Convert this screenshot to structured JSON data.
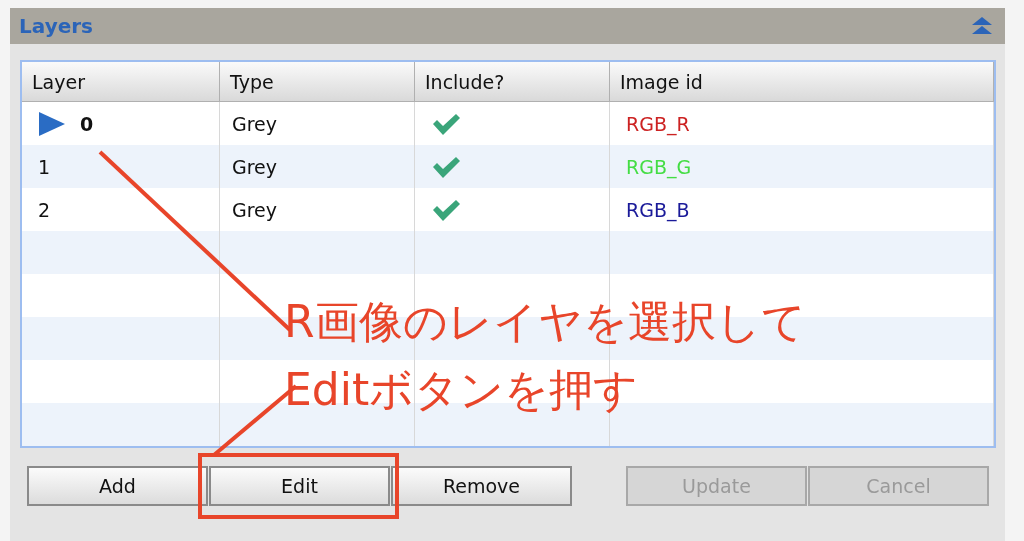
{
  "panel": {
    "title": "Layers",
    "collapsed": false
  },
  "table": {
    "columns": [
      "Layer",
      "Type",
      "Include?",
      "Image id"
    ],
    "rows": [
      {
        "layer": "0",
        "type": "Grey",
        "include": true,
        "image_id": "RGB_R",
        "color": "#cc2222",
        "selected": true
      },
      {
        "layer": "1",
        "type": "Grey",
        "include": true,
        "image_id": "RGB_G",
        "color": "#44dd44",
        "selected": false
      },
      {
        "layer": "2",
        "type": "Grey",
        "include": true,
        "image_id": "RGB_B",
        "color": "#1a1a99",
        "selected": false
      }
    ]
  },
  "buttons": [
    {
      "label": "Add",
      "disabled": false,
      "highlighted": false
    },
    {
      "label": "Edit",
      "disabled": false,
      "highlighted": true
    },
    {
      "label": "Remove",
      "disabled": false,
      "highlighted": false
    }
  ],
  "form_buttons": [
    {
      "label": "Update",
      "disabled": true
    },
    {
      "label": "Cancel",
      "disabled": true
    }
  ],
  "annotation": {
    "lines": [
      "R画像のレイヤを選択して",
      "Editボタンを押す"
    ]
  }
}
